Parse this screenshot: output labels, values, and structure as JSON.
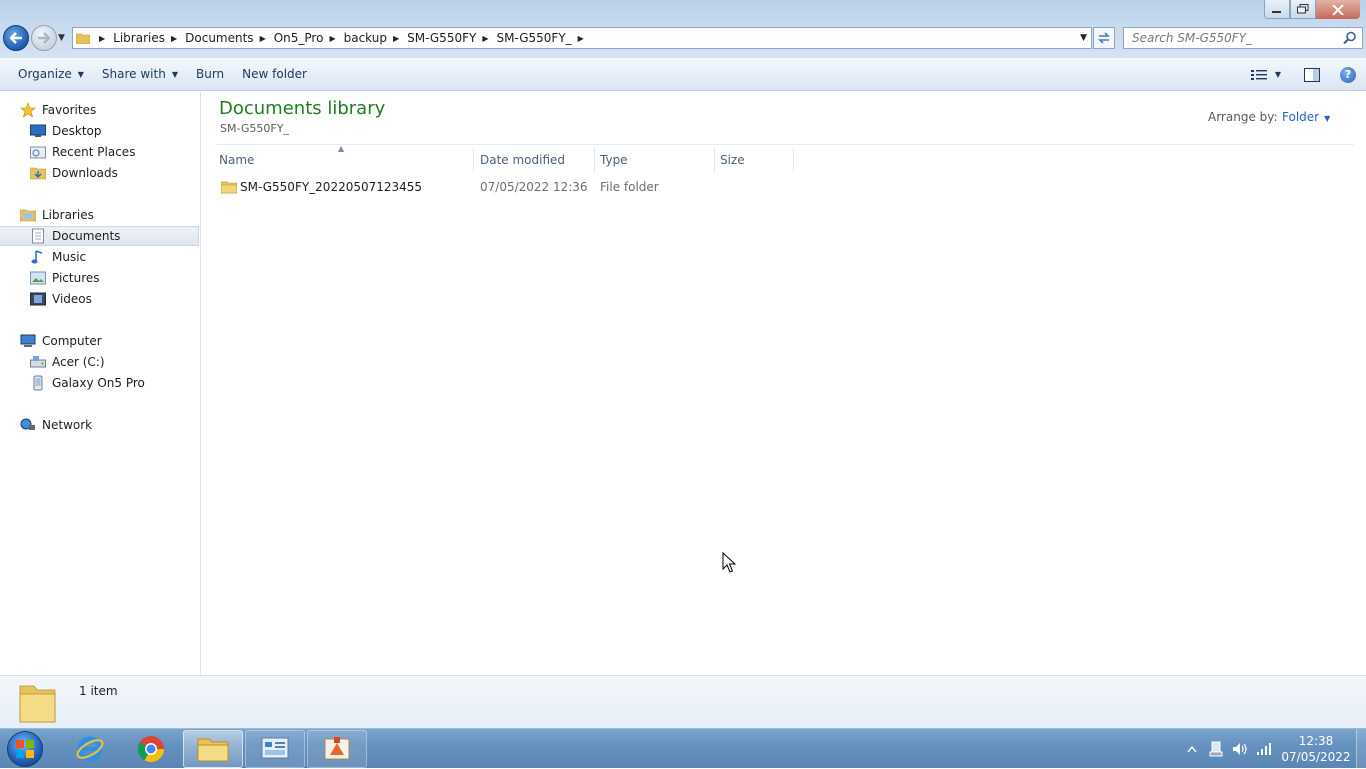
{
  "window": {
    "caption": {
      "minimize": "▁",
      "maximize": "❐",
      "close": "✕"
    }
  },
  "address": {
    "crumbs": [
      "Libraries",
      "Documents",
      "On5_Pro",
      "backup",
      "SM-G550FY",
      "SM-G550FY_"
    ],
    "search_placeholder": "Search SM-G550FY_"
  },
  "toolbar": {
    "organize": "Organize",
    "share_with": "Share with",
    "burn": "Burn",
    "new_folder": "New folder"
  },
  "nav": {
    "favorites": "Favorites",
    "desktop": "Desktop",
    "recent_places": "Recent Places",
    "downloads": "Downloads",
    "libraries": "Libraries",
    "documents": "Documents",
    "music": "Music",
    "pictures": "Pictures",
    "videos": "Videos",
    "computer": "Computer",
    "acer_c": "Acer (C:)",
    "galaxy": "Galaxy On5 Pro",
    "network": "Network"
  },
  "content": {
    "title": "Documents library",
    "subtitle": "SM-G550FY_",
    "arrange_label": "Arrange by:",
    "arrange_value": "Folder",
    "columns": {
      "name": "Name",
      "date": "Date modified",
      "type": "Type",
      "size": "Size"
    },
    "files": [
      {
        "name": "SM-G550FY_20220507123455",
        "date": "07/05/2022 12:36",
        "type": "File folder",
        "size": ""
      }
    ]
  },
  "details": {
    "count": "1 item"
  },
  "taskbar": {
    "time": "12:38",
    "date": "07/05/2022"
  },
  "colors": {
    "title_green": "#1e7f1e",
    "link_blue": "#1f64c0",
    "taskbar": "#6592bf"
  }
}
